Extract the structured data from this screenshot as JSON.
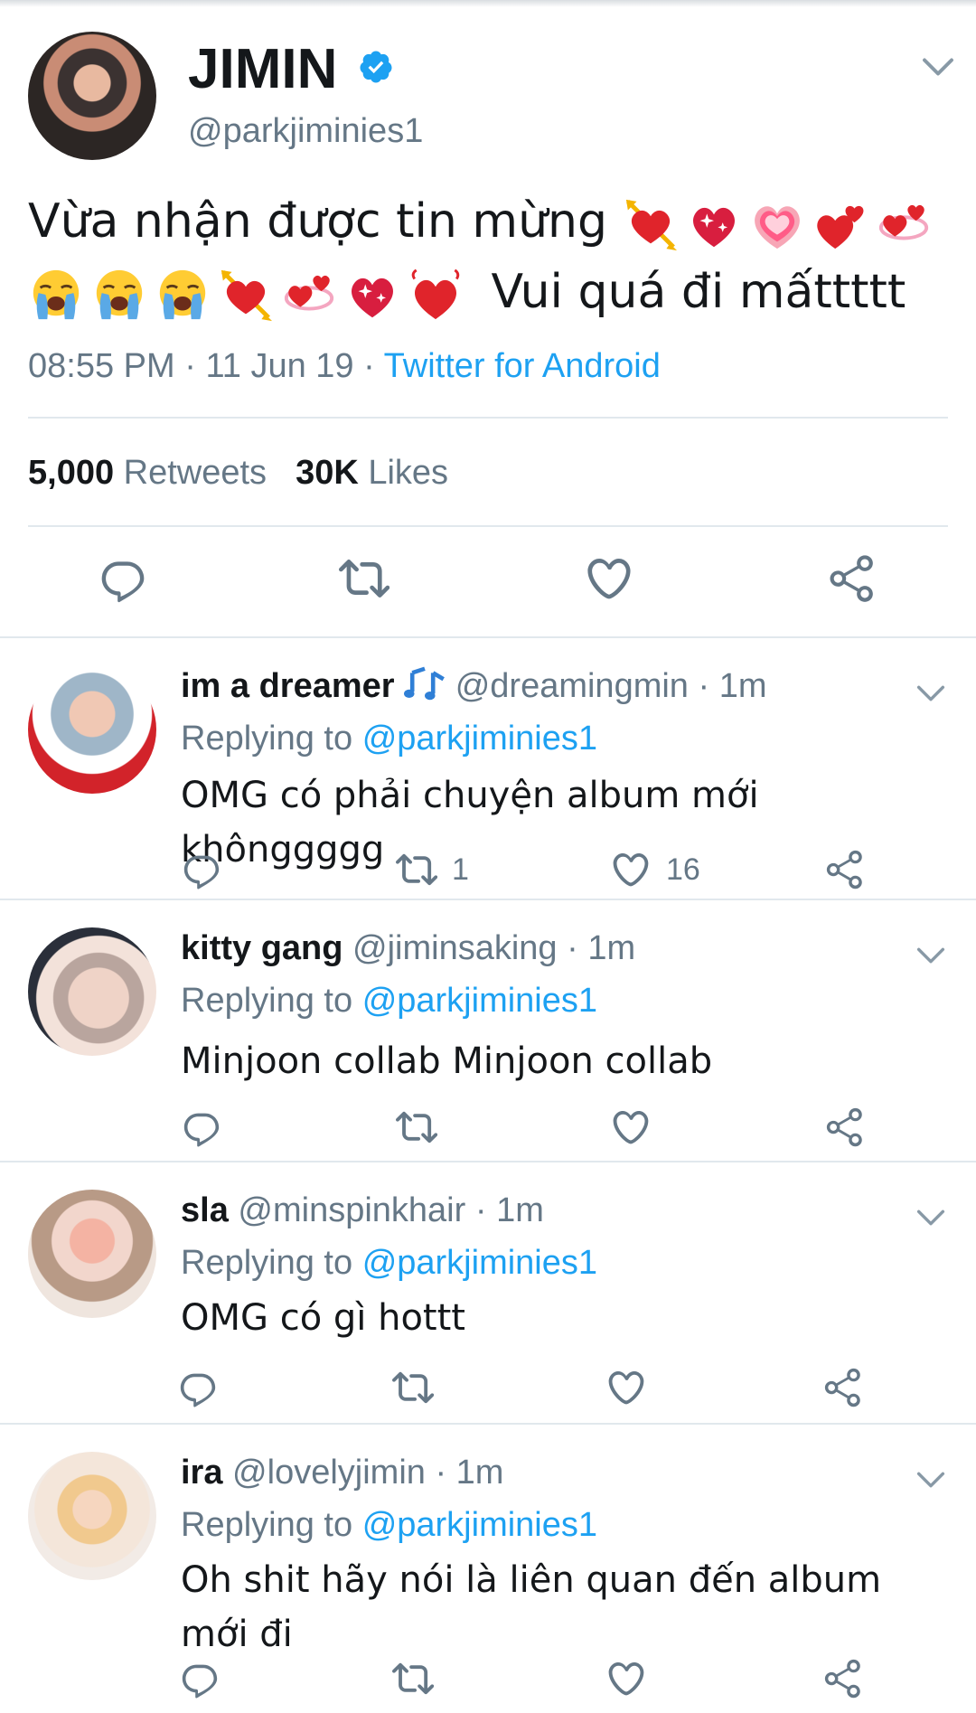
{
  "main_tweet": {
    "display_name": "JIMIN",
    "handle": "@parkjiminies1",
    "text_part1": "Vừa nhận được tin mừng",
    "text_part2": "Vui quá đi mấttttt",
    "time": "08:55 PM",
    "date": "11 Jun 19",
    "source": "Twitter for Android",
    "retweets_count": "5,000",
    "retweets_label": "Retweets",
    "likes_count": "30K",
    "likes_label": "Likes",
    "emojis_line1": [
      "heart-with-arrow",
      "sparkling-heart",
      "growing-heart",
      "two-hearts",
      "revolving-hearts"
    ],
    "emojis_line2": [
      "loudly-crying-face",
      "loudly-crying-face",
      "loudly-crying-face",
      "heart-with-arrow",
      "revolving-hearts",
      "sparkling-heart",
      "beating-heart"
    ]
  },
  "replies": [
    {
      "name": "im a dreamer",
      "has_music_icon": true,
      "handle": "@dreamingmin",
      "time": "1m",
      "replying_label": "Replying to",
      "mention": "@parkjiminies1",
      "text": "OMG có phải chuyện album mới khônggggg",
      "retweets": "1",
      "likes": "16"
    },
    {
      "name": "kitty gang",
      "handle": "@jiminsaking",
      "time": "1m",
      "replying_label": "Replying to",
      "mention": "@parkjiminies1",
      "text": "Minjoon collab Minjoon collab",
      "retweets": "",
      "likes": ""
    },
    {
      "name": "sla",
      "handle": "@minspinkhair",
      "time": "1m",
      "replying_label": "Replying to",
      "mention": "@parkjiminies1",
      "text": "OMG có gì hottt",
      "retweets": "",
      "likes": ""
    },
    {
      "name": "ira",
      "handle": "@lovelyjimin",
      "time": "1m",
      "replying_label": "Replying to",
      "mention": "@parkjiminies1",
      "text": "Oh shit hãy nói là liên quan đến album mới đi",
      "retweets": "",
      "likes": ""
    }
  ],
  "colors": {
    "text": "#14171a",
    "secondary": "#657786",
    "link": "#1da1f2",
    "divider": "#e1e8ed",
    "icon": "#657786"
  }
}
